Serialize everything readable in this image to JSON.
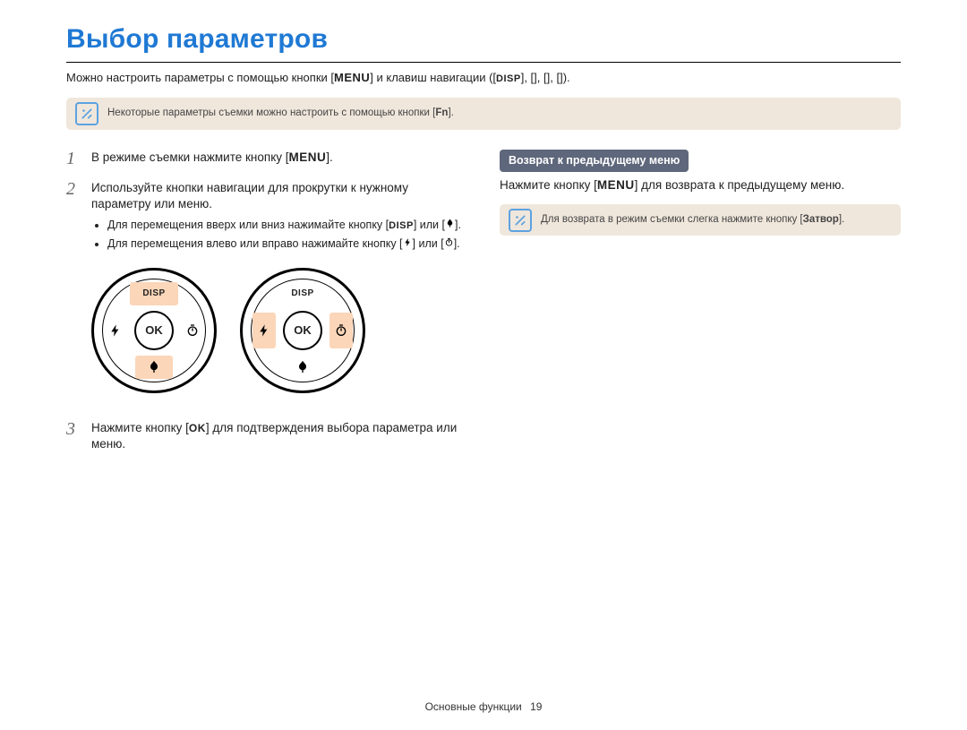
{
  "title": "Выбор параметров",
  "intro": {
    "prefix": "Можно настроить параметры с помощью кнопки [",
    "menu_glyph": "MENU",
    "mid1": "] и клавиш навигации ([",
    "disp_glyph": "DISP",
    "mid2": "], [",
    "mid3": "], [",
    "mid4": "], [",
    "end": "])."
  },
  "top_info": {
    "text_prefix": "Некоторые параметры съемки можно настроить с помощью кнопки [",
    "fn_glyph": "Fn",
    "text_suffix": "]."
  },
  "left": {
    "step1": {
      "num": "1",
      "text_prefix": "В режиме съемки нажмите кнопку [",
      "menu_glyph": "MENU",
      "text_suffix": "]."
    },
    "step2": {
      "num": "2",
      "text": "Используйте кнопки навигации для прокрутки к нужному параметру или меню.",
      "bullet1_prefix": "Для перемещения вверх или вниз нажимайте кнопку [",
      "disp_glyph": "DISP",
      "bullet1_mid": "] или [",
      "bullet1_suffix": "].",
      "bullet2_prefix": "Для перемещения влево или вправо нажимайте кнопку [",
      "bullet2_mid": "] или [",
      "bullet2_suffix": "]."
    },
    "dial_disp": "DISP",
    "dial_ok": "OK",
    "step3": {
      "num": "3",
      "text_prefix": "Нажмите кнопку [",
      "ok_glyph": "OK",
      "text_suffix": "] для подтверждения выбора параметра или меню."
    }
  },
  "right": {
    "heading": "Возврат к предыдущему меню",
    "line_prefix": "Нажмите кнопку [",
    "menu_glyph": "MENU",
    "line_suffix": "] для возврата к предыдущему меню.",
    "info_prefix": "Для возврата в режим съемки слегка нажмите кнопку [",
    "info_bold": "Затвор",
    "info_suffix": "]."
  },
  "footer": {
    "section": "Основные функции",
    "page": "19"
  }
}
